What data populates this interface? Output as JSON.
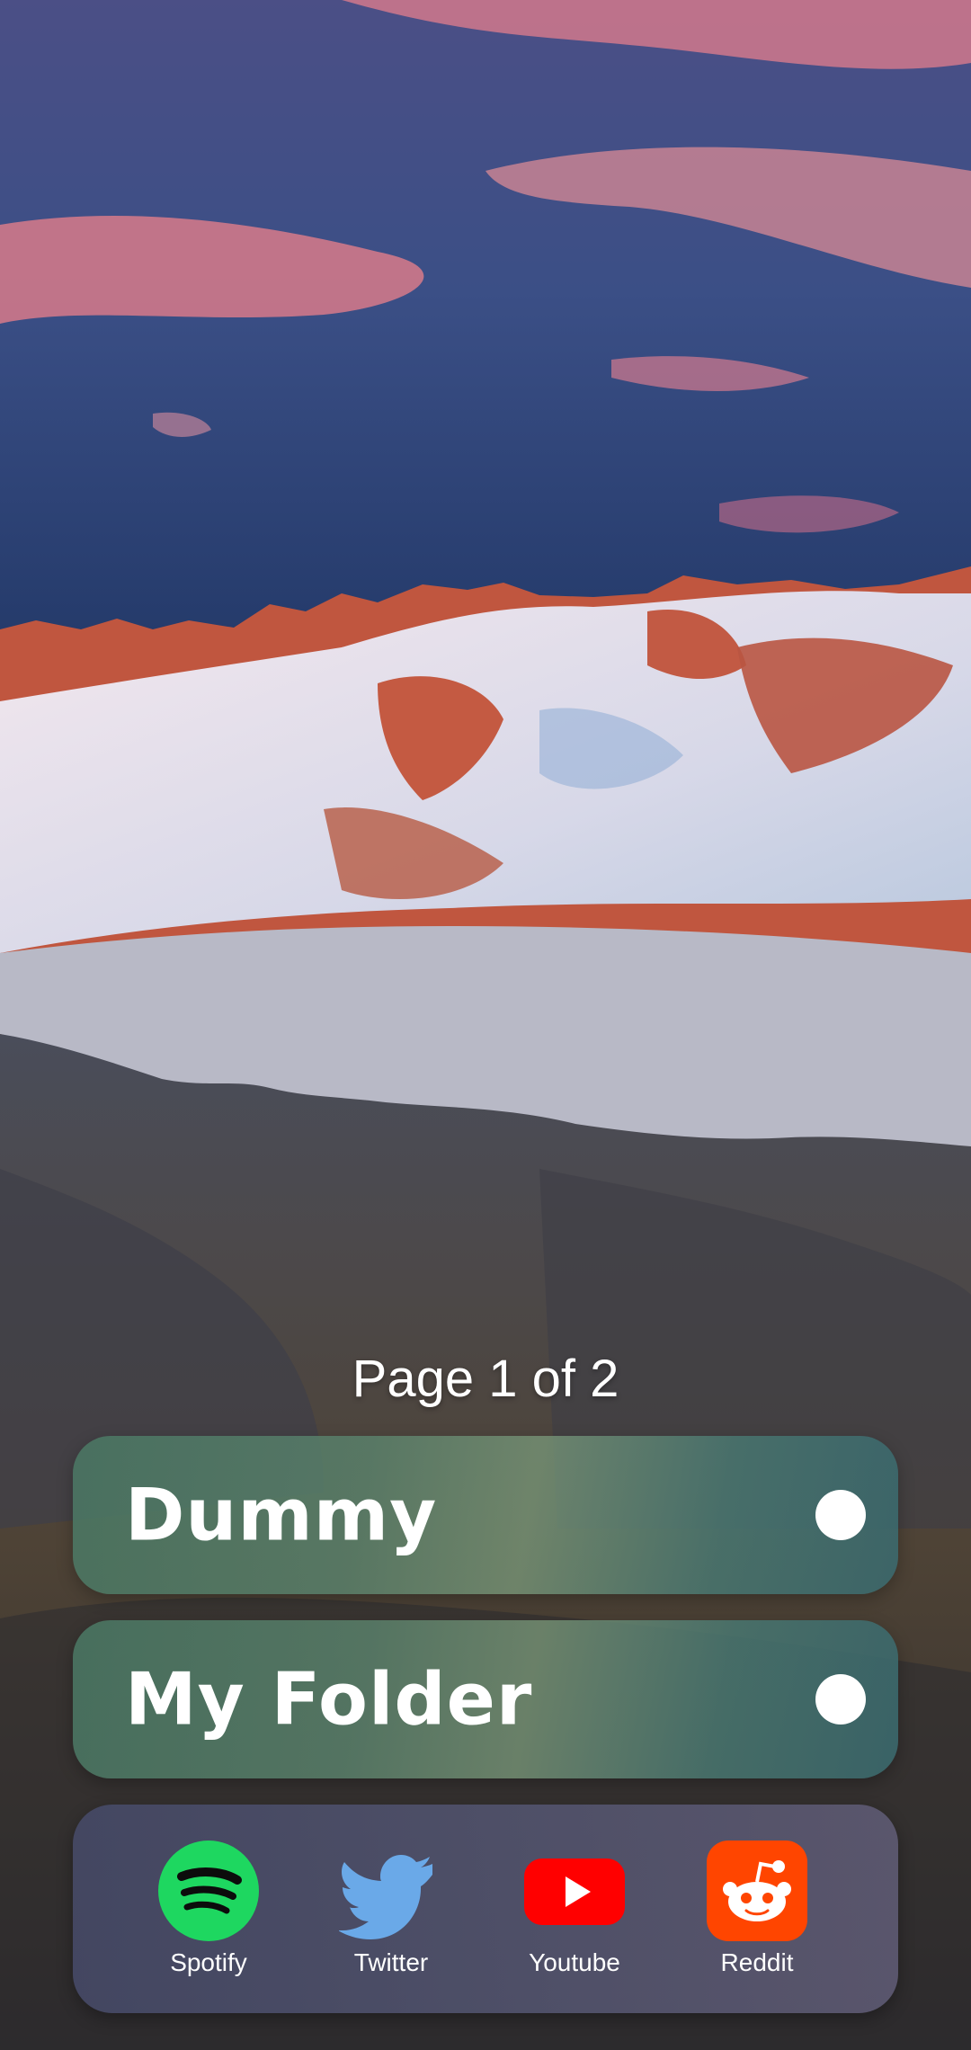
{
  "page_indicator": "Page 1 of 2",
  "folders": [
    {
      "title": "Dummy"
    },
    {
      "title": "My Folder"
    }
  ],
  "dock": {
    "apps": [
      {
        "label": "Spotify",
        "icon": "spotify-icon",
        "color": "#1ed760"
      },
      {
        "label": "Twitter",
        "icon": "twitter-icon",
        "color": "#6aa9e8"
      },
      {
        "label": "Youtube",
        "icon": "youtube-icon",
        "color": "#ff0000"
      },
      {
        "label": "Reddit",
        "icon": "reddit-icon",
        "color": "#ff4500"
      }
    ]
  }
}
